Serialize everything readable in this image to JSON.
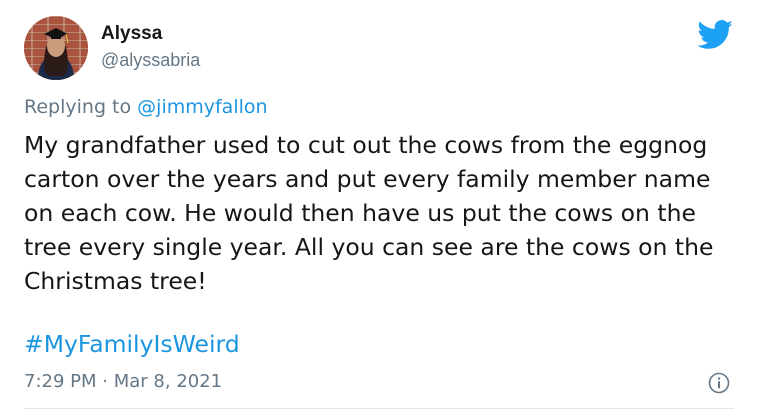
{
  "author": {
    "display_name": "Alyssa",
    "handle": "@alyssabria"
  },
  "reply": {
    "prefix": "Replying to",
    "mention": "@jimmyfallon"
  },
  "tweet": {
    "text": "My grandfather used to cut out the cows from the eggnog carton over the years and put every family member name on each cow. He would then have us put the cows on the tree every single year. All you can see are the cows on the Christmas tree!",
    "hashtag": "#MyFamilyIsWeird",
    "time": "7:29 PM",
    "separator": "·",
    "date": "Mar 8, 2021"
  },
  "icons": {
    "brand": "twitter-bird-icon",
    "info": "info-icon"
  },
  "colors": {
    "brand_blue": "#1da1f2",
    "link_blue": "#1b95e0",
    "secondary_text": "#657786",
    "primary_text": "#14171a",
    "divider": "#e1e8ed"
  }
}
